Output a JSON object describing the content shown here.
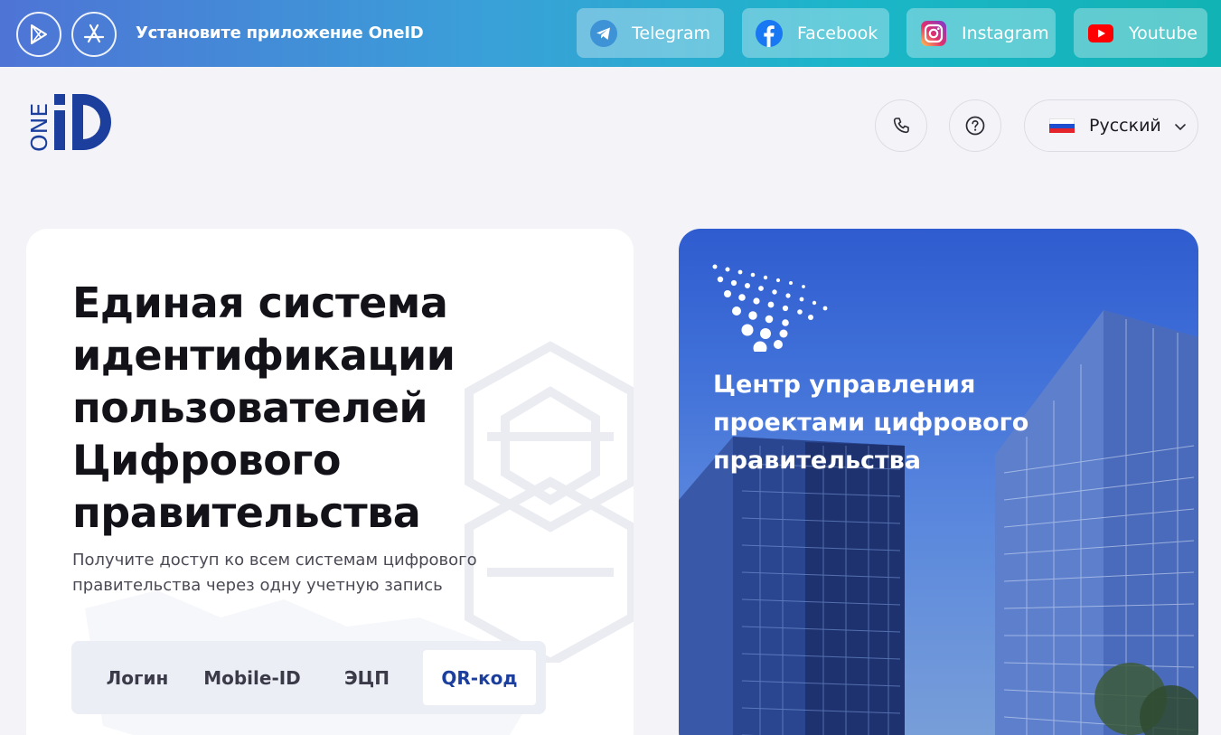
{
  "banner": {
    "install_text": "Установите приложение OneID",
    "stores": [
      {
        "icon": "google-play-icon"
      },
      {
        "icon": "app-store-icon"
      }
    ],
    "socials": [
      {
        "label": "Telegram",
        "icon": "telegram-icon",
        "color": "#3e93d6"
      },
      {
        "label": "Facebook",
        "icon": "facebook-icon",
        "color": "#1877f2"
      },
      {
        "label": "Instagram",
        "icon": "instagram-icon",
        "color": "#e1306c"
      },
      {
        "label": "Youtube",
        "icon": "youtube-icon",
        "color": "#ff0000"
      }
    ]
  },
  "header": {
    "logo_text": "ONE",
    "phone_icon": "phone-icon",
    "help_icon": "question-icon",
    "language": "Русский"
  },
  "main": {
    "title": "Единая система идентификации пользователей Цифрового правительства",
    "subtitle": "Получите доступ ко всем системам цифрового правительства через одну учетную запись",
    "tabs": [
      {
        "label": "Логин",
        "active": false
      },
      {
        "label": "Mobile-ID",
        "active": false
      },
      {
        "label": "ЭЦП",
        "active": false
      },
      {
        "label": "QR-код",
        "active": true
      }
    ]
  },
  "hero": {
    "title": "Центр управления проектами цифрового правительства"
  },
  "colors": {
    "brand_blue": "#1c3f9e",
    "banner_start": "#4e74d6",
    "banner_end": "#12b3b4"
  }
}
